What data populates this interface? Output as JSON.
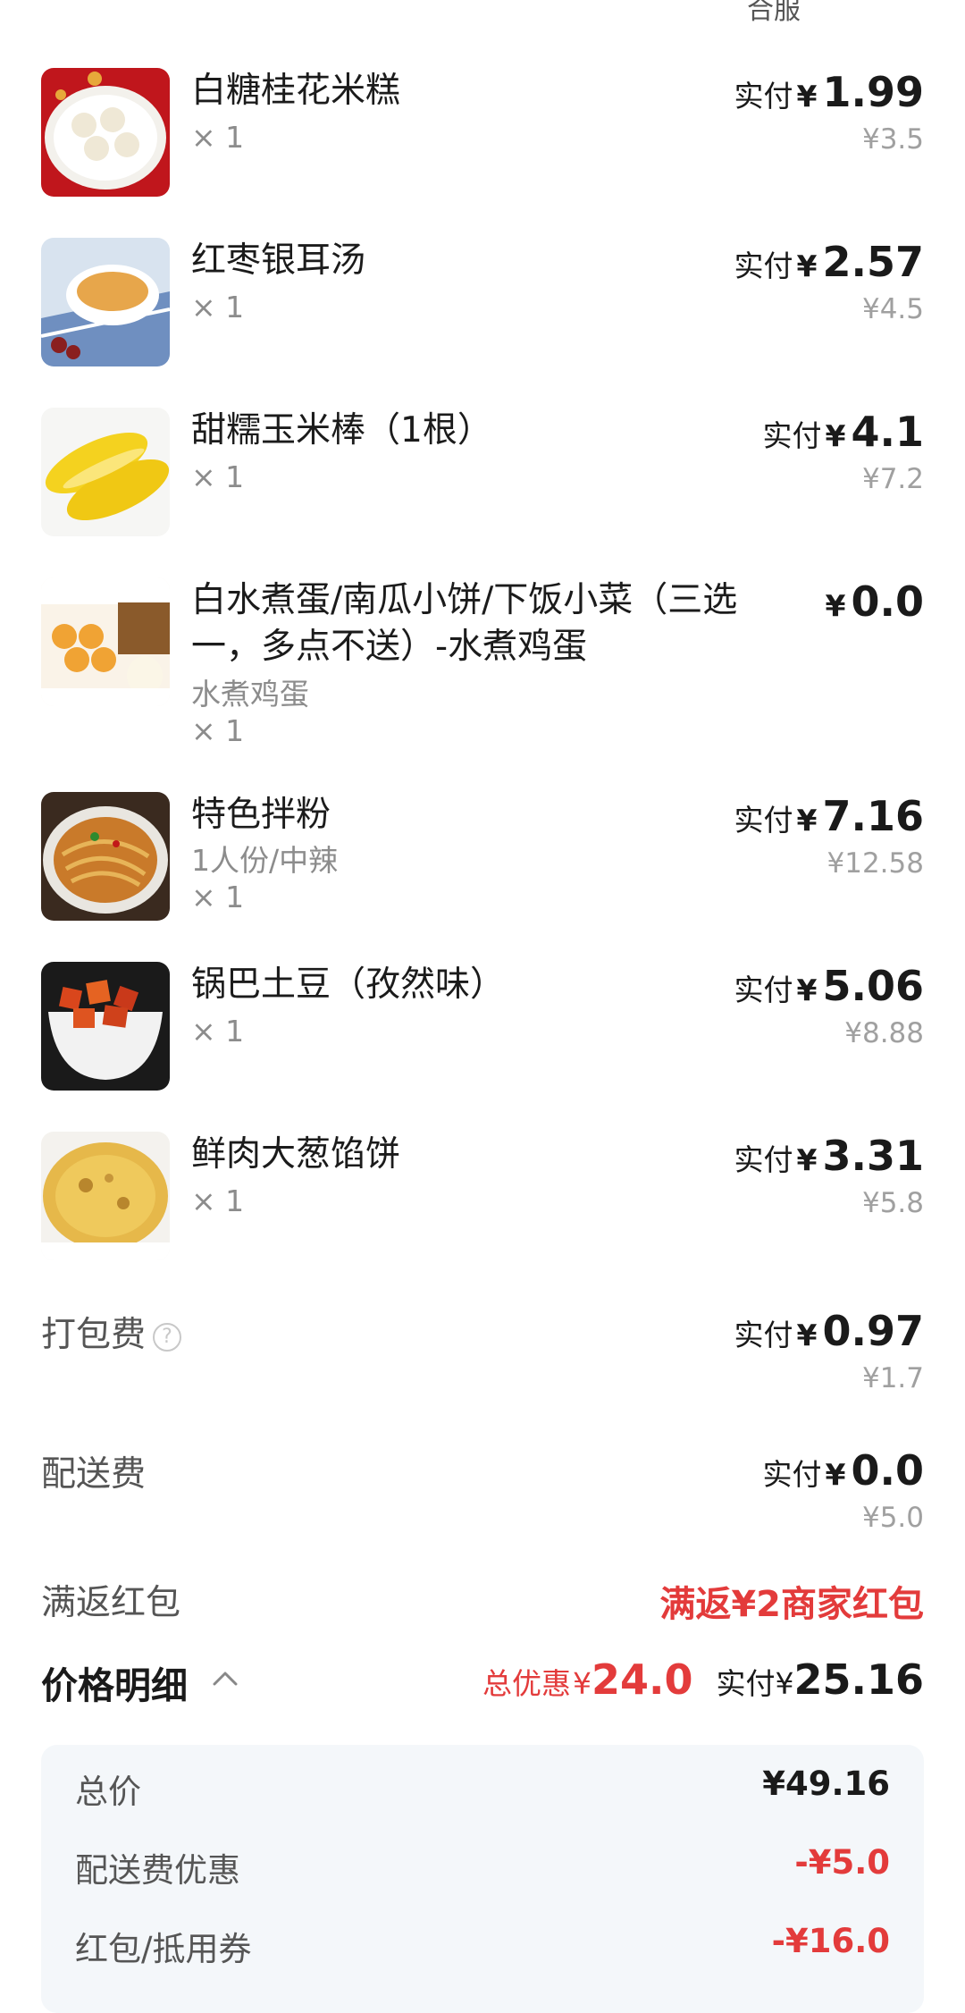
{
  "top_fragment": "合服",
  "items": [
    {
      "name": "白糖桂花米糕",
      "spec": "",
      "qty": "× 1",
      "paid_label": "实付",
      "currency": "¥",
      "paid": "1.99",
      "original": "¥3.5",
      "image": "rice-cake-photo"
    },
    {
      "name": "红枣银耳汤",
      "spec": "",
      "qty": "× 1",
      "paid_label": "实付",
      "currency": "¥",
      "paid": "2.57",
      "original": "¥4.5",
      "image": "tremella-soup-photo"
    },
    {
      "name": "甜糯玉米棒（1根）",
      "spec": "",
      "qty": "× 1",
      "paid_label": "实付",
      "currency": "¥",
      "paid": "4.1",
      "original": "¥7.2",
      "image": "corn-photo"
    },
    {
      "name": "白水煮蛋/南瓜小饼/下饭小菜（三选一，多点不送）-水煮鸡蛋",
      "spec": "水煮鸡蛋",
      "qty": "× 1",
      "paid_label": "",
      "currency": "¥",
      "paid": "0.0",
      "original": "",
      "image": "boiled-egg-combo-photo"
    },
    {
      "name": "特色拌粉",
      "spec": "1人份/中辣",
      "qty": "× 1",
      "paid_label": "实付",
      "currency": "¥",
      "paid": "7.16",
      "original": "¥12.58",
      "image": "noodles-photo"
    },
    {
      "name": "锅巴土豆（孜然味）",
      "spec": "",
      "qty": "× 1",
      "paid_label": "实付",
      "currency": "¥",
      "paid": "5.06",
      "original": "¥8.88",
      "image": "potato-photo"
    },
    {
      "name": "鲜肉大葱馅饼",
      "spec": "",
      "qty": "× 1",
      "paid_label": "实付",
      "currency": "¥",
      "paid": "3.31",
      "original": "¥5.8",
      "image": "meat-pie-photo"
    }
  ],
  "packing": {
    "label": "打包费",
    "help_icon": "question-circle-icon",
    "paid_label": "实付",
    "currency": "¥",
    "paid": "0.97",
    "original": "¥1.7"
  },
  "delivery": {
    "label": "配送费",
    "paid_label": "实付",
    "currency": "¥",
    "paid": "0.0",
    "original": "¥5.0"
  },
  "red_packet": {
    "label": "满返红包",
    "value": "满返¥2商家红包"
  },
  "price_detail": {
    "title": "价格明细",
    "toggle_icon": "chevron-up-icon",
    "total_discount_label": "总优惠",
    "total_discount_currency": "¥",
    "total_discount": "24.0",
    "paid_label": "实付",
    "paid_currency": "¥",
    "paid": "25.16",
    "rows": [
      {
        "label": "总价",
        "value": "¥49.16"
      },
      {
        "label": "配送费优惠",
        "value": "-¥5.0"
      },
      {
        "label": "红包/抵用券",
        "value": "-¥16.0"
      }
    ]
  },
  "colors": {
    "accent_red": "#e33b3b",
    "text_dark": "#1a1a1a",
    "text_gray": "#8c8c8c",
    "detail_bg": "#f4f7fa"
  }
}
